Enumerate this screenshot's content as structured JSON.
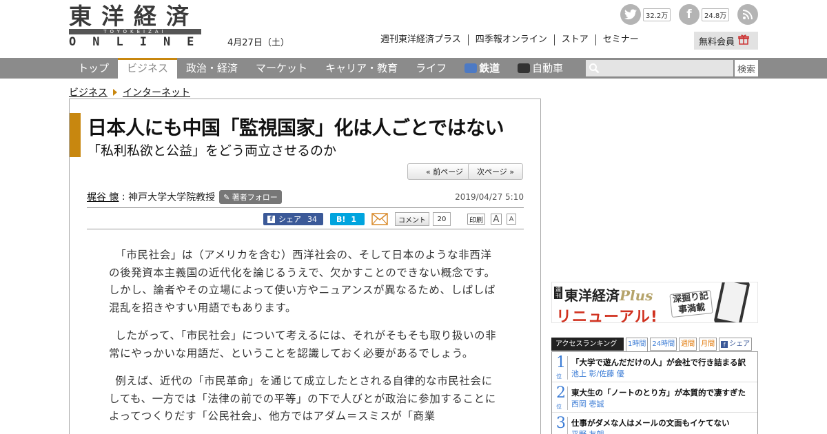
{
  "header": {
    "logo_kanji": "東洋経済",
    "logo_romaji": "TOYOKEIZAI",
    "logo_online": "ONLINE",
    "date": "4月27日（土）",
    "social": {
      "twitter_count": "32.2万",
      "facebook_count": "24.8万"
    },
    "links": [
      "週刊東洋経済プラス",
      "四季報オンライン",
      "ストア",
      "セミナー"
    ],
    "member_button": "無料会員"
  },
  "nav": {
    "items": [
      {
        "label": "トップ"
      },
      {
        "label": "ビジネス"
      },
      {
        "label": "政治・経済"
      },
      {
        "label": "マーケット"
      },
      {
        "label": "キャリア・教育"
      },
      {
        "label": "ライフ"
      },
      {
        "label": "鉄道"
      },
      {
        "label": "自動車"
      }
    ],
    "active": "ビジネス",
    "search_placeholder": "",
    "search_button": "検索"
  },
  "breadcrumb": [
    "ビジネス",
    "インターネット"
  ],
  "article": {
    "title": "日本人にも中国「監視国家」化は人ごとではない",
    "subtitle": "「私利私欲と公益」をどう両立させるのか",
    "prev_page": "« 前ページ",
    "next_page": "次ページ »",
    "author_name": "梶谷 懐",
    "author_title": "神戸大学大学院教授",
    "follow_label": "著者フォロー",
    "pubdate": "2019/04/27 5:10",
    "share": {
      "fb_label": "シェア",
      "fb_count": "34",
      "hatena_label": "B!",
      "hatena_count": "1",
      "comment_label": "コメント",
      "comment_count": "20",
      "print_label": "印刷",
      "font_large": "A",
      "font_small": "A"
    },
    "paragraphs": [
      "「市民社会」は（アメリカを含む）西洋社会の、そして日本のような非西洋の後発資本主義国の近代化を論じるうえで、欠かすことのできない概念です。しかし、論者やその立場によって使い方やニュアンスが異なるため、しばしば混乱を招きやすい用語でもあります。",
      "したがって、「市民社会」について考えるには、それがそもそも取り扱いの非常にやっかいな用語だ、ということを認識しておく必要があるでしょう。",
      "例えば、近代の「市民革命」を通じて成立したとされる自律的な市民社会にしても、一方では「法律の前での平等」の下で人びとが政治に参加することによってつくりだす「公民社会」、他方ではアダム＝スミスが「商業"
    ]
  },
  "sidebar": {
    "banner": {
      "weekly": "週刊",
      "title": "東洋経済",
      "plus": "Plus",
      "renewal": "リニューアル!",
      "tag": "深掘り記事満載"
    },
    "ranking": {
      "title": "アクセスランキング",
      "tabs": [
        "1時間",
        "24時間",
        "週間",
        "月間",
        "シェア"
      ],
      "suffix": "位",
      "items": [
        {
          "rank": "1",
          "title": "「大学で遊んだだけの人」が会社で行き詰まる訳",
          "author": "池上 彰/佐藤 優"
        },
        {
          "rank": "2",
          "title": "東大生の「ノートのとり方」が本質的で凄すぎた",
          "author": "西岡 壱誠"
        },
        {
          "rank": "3",
          "title": "仕事がダメな人はメールの文面もイケてない",
          "author": "平野 友朗"
        }
      ]
    }
  },
  "colors": {
    "accent": "#c8870f",
    "nav_bg": "#8b8b8b",
    "facebook": "#3b5998",
    "hatena": "#00a4de",
    "rank_blue": "#3a7bd5"
  }
}
